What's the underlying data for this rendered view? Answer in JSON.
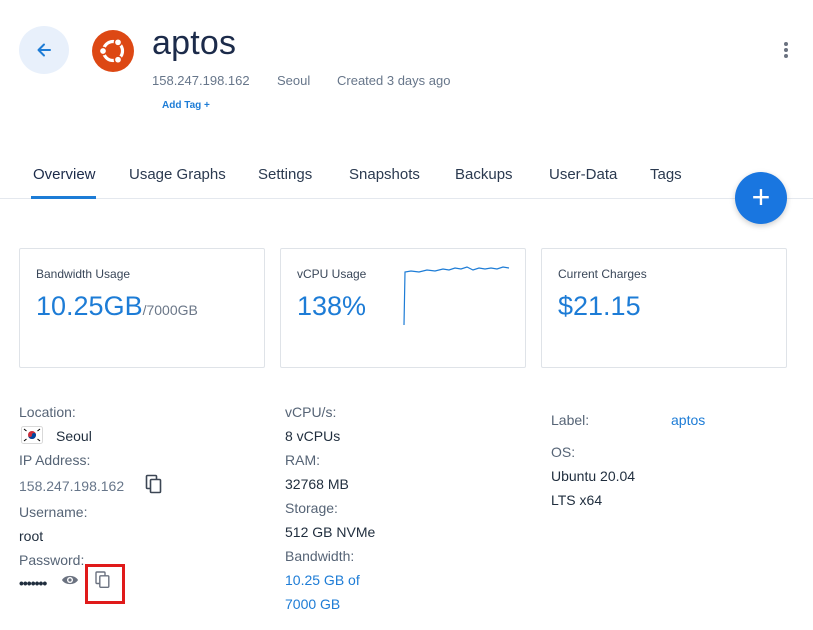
{
  "header": {
    "title": "aptos",
    "ip": "158.247.198.162",
    "location": "Seoul",
    "created": "Created 3 days ago",
    "add_tag": "Add Tag +"
  },
  "tabs": [
    {
      "label": "Overview",
      "active": true
    },
    {
      "label": "Usage Graphs"
    },
    {
      "label": "Settings"
    },
    {
      "label": "Snapshots"
    },
    {
      "label": "Backups"
    },
    {
      "label": "User-Data"
    },
    {
      "label": "Tags"
    }
  ],
  "fab": {
    "icon": "plus-icon",
    "label": "+"
  },
  "cards": {
    "bandwidth": {
      "label": "Bandwidth Usage",
      "value": "10.25GB",
      "unit": "/7000GB"
    },
    "vcpu": {
      "label": "vCPU Usage",
      "value": "138%"
    },
    "charges": {
      "label": "Current Charges",
      "value": "$21.15"
    }
  },
  "details_left": {
    "location_label": "Location:",
    "location_value": "Seoul",
    "ip_label": "IP Address:",
    "ip_value": "158.247.198.162",
    "username_label": "Username:",
    "username_value": "root",
    "password_label": "Password:",
    "password_value": "•••••••"
  },
  "details_mid": {
    "vcpu_label": "vCPU/s:",
    "vcpu_value": "8 vCPUs",
    "ram_label": "RAM:",
    "ram_value": "32768 MB",
    "storage_label": "Storage:",
    "storage_value": "512 GB NVMe",
    "bandwidth_label": "Bandwidth:",
    "bandwidth_line1": "10.25 GB of",
    "bandwidth_line2": "7000 GB"
  },
  "details_right": {
    "label_label": "Label:",
    "label_value": "aptos",
    "os_label": "OS:",
    "os_line1": "Ubuntu 20.04",
    "os_line2": "LTS x64"
  },
  "colors": {
    "accent": "#1d7cd6",
    "fab": "#1976e0",
    "ubuntu": "#dd4814",
    "highlight": "#e01a1a"
  }
}
